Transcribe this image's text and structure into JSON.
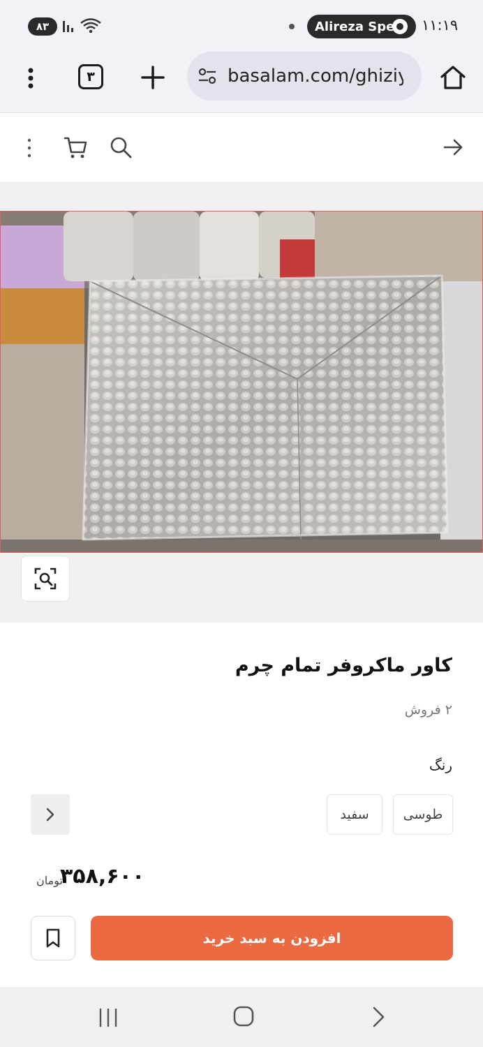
{
  "status_bar": {
    "battery": "۸۳",
    "recording_label": "Alireza Spe",
    "time": "۱۱:۱۹"
  },
  "browser": {
    "tab_count": "۳",
    "url": "basalam.com/ghiziy"
  },
  "product": {
    "title": "کاور ماکروفر تمام چرم",
    "sold_count": "۲ فروش",
    "color_label": "رنگ",
    "color_options": [
      "طوسی",
      "سفید"
    ],
    "price": "۳۵۸,۶۰۰",
    "currency": "تومان",
    "add_to_cart_label": "افزودن به سبد خرید"
  },
  "icons": {
    "menu": "more-vert-icon",
    "tabs": "tab-switcher-icon",
    "new_tab": "plus-icon",
    "site_settings": "tune-icon",
    "home": "home-icon",
    "cart": "cart-icon",
    "search": "search-icon",
    "back": "arrow-right-icon",
    "image_search": "lens-icon",
    "bookmark": "bookmark-icon"
  },
  "colors": {
    "accent": "#ec6a42",
    "browser_bg": "#f3f1f8",
    "urlbar_bg": "#e5e2ec"
  }
}
